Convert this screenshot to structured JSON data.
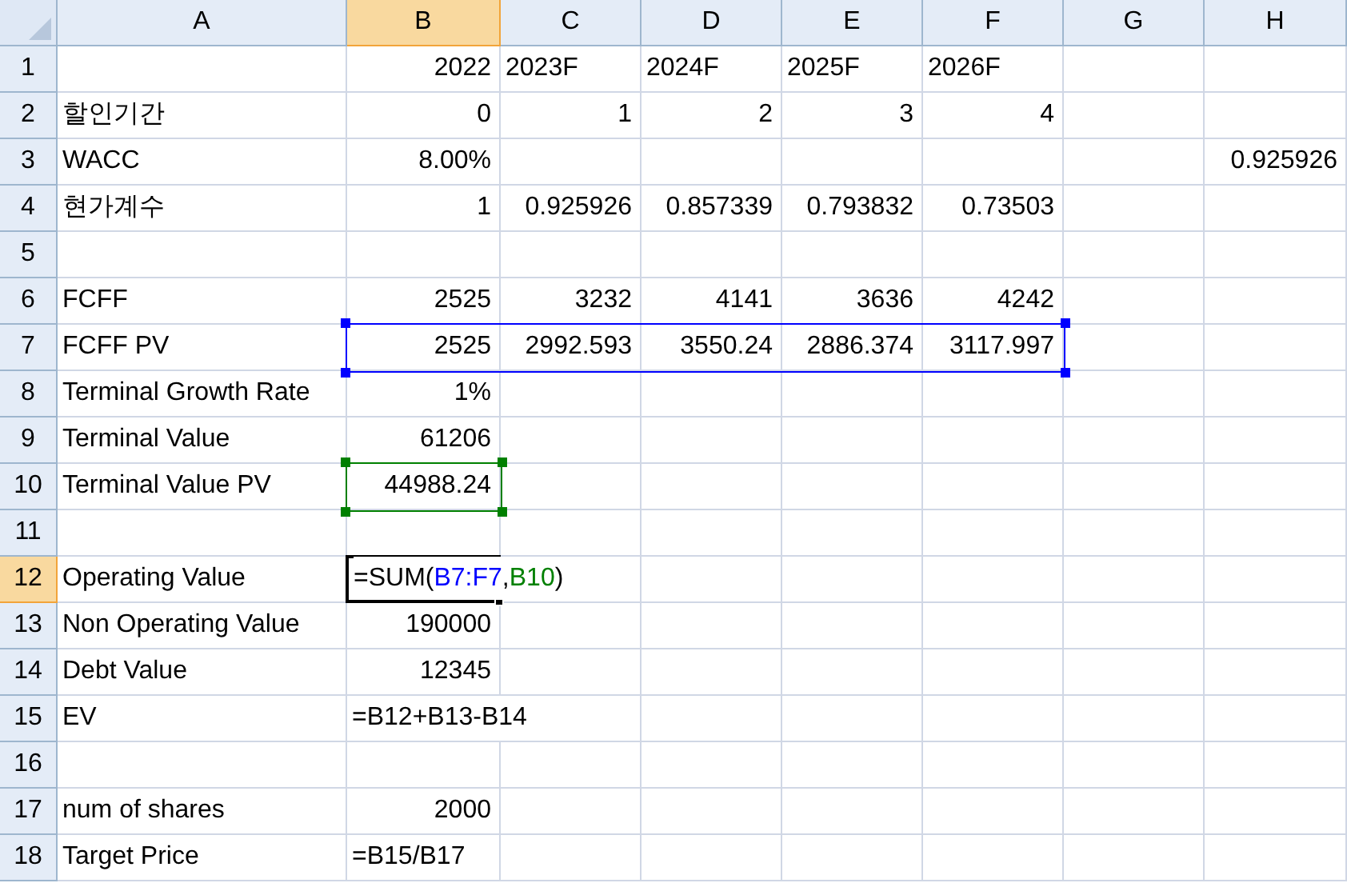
{
  "columns": [
    {
      "label": "A",
      "selected": false
    },
    {
      "label": "B",
      "selected": true
    },
    {
      "label": "C",
      "selected": false
    },
    {
      "label": "D",
      "selected": false
    },
    {
      "label": "E",
      "selected": false
    },
    {
      "label": "F",
      "selected": false
    },
    {
      "label": "G",
      "selected": false
    },
    {
      "label": "H",
      "selected": false
    }
  ],
  "rows": [
    {
      "number": "1",
      "selected": false,
      "cells": [
        null,
        {
          "kind": "number",
          "text": "2022"
        },
        {
          "kind": "text",
          "text": "2023F"
        },
        {
          "kind": "text",
          "text": "2024F"
        },
        {
          "kind": "text",
          "text": "2025F"
        },
        {
          "kind": "text",
          "text": "2026F"
        },
        null,
        null
      ]
    },
    {
      "number": "2",
      "selected": false,
      "cells": [
        {
          "kind": "text",
          "text": "할인기간"
        },
        {
          "kind": "number",
          "text": "0"
        },
        {
          "kind": "number",
          "text": "1"
        },
        {
          "kind": "number",
          "text": "2"
        },
        {
          "kind": "number",
          "text": "3"
        },
        {
          "kind": "number",
          "text": "4"
        },
        null,
        null
      ]
    },
    {
      "number": "3",
      "selected": false,
      "cells": [
        {
          "kind": "text",
          "text": "WACC"
        },
        {
          "kind": "number",
          "text": "8.00%"
        },
        null,
        null,
        null,
        null,
        null,
        {
          "kind": "number",
          "text": "0.925926"
        }
      ]
    },
    {
      "number": "4",
      "selected": false,
      "cells": [
        {
          "kind": "text",
          "text": "현가계수"
        },
        {
          "kind": "number",
          "text": "1"
        },
        {
          "kind": "number",
          "text": "0.925926"
        },
        {
          "kind": "number",
          "text": "0.857339"
        },
        {
          "kind": "number",
          "text": "0.793832"
        },
        {
          "kind": "number",
          "text": "0.73503"
        },
        null,
        null
      ]
    },
    {
      "number": "5",
      "selected": false,
      "cells": [
        null,
        null,
        null,
        null,
        null,
        null,
        null,
        null
      ]
    },
    {
      "number": "6",
      "selected": false,
      "cells": [
        {
          "kind": "text",
          "text": "FCFF"
        },
        {
          "kind": "number",
          "text": "2525"
        },
        {
          "kind": "number",
          "text": "3232"
        },
        {
          "kind": "number",
          "text": "4141"
        },
        {
          "kind": "number",
          "text": "3636"
        },
        {
          "kind": "number",
          "text": "4242"
        },
        null,
        null
      ]
    },
    {
      "number": "7",
      "selected": false,
      "cells": [
        {
          "kind": "text",
          "text": "FCFF PV"
        },
        {
          "kind": "number",
          "text": "2525",
          "color": "#0000ff"
        },
        {
          "kind": "number",
          "text": "2992.593",
          "color": "#0000ff"
        },
        {
          "kind": "number",
          "text": "3550.24",
          "color": "#0000ff"
        },
        {
          "kind": "number",
          "text": "2886.374",
          "color": "#0000ff"
        },
        {
          "kind": "number",
          "text": "3117.997",
          "color": "#0000ff"
        },
        null,
        null
      ]
    },
    {
      "number": "8",
      "selected": false,
      "cells": [
        {
          "kind": "text",
          "text": "Terminal Growth Rate"
        },
        {
          "kind": "number",
          "text": "1%"
        },
        null,
        null,
        null,
        null,
        null,
        null
      ]
    },
    {
      "number": "9",
      "selected": false,
      "cells": [
        {
          "kind": "text",
          "text": "Terminal Value"
        },
        {
          "kind": "number",
          "text": "61206"
        },
        null,
        null,
        null,
        null,
        null,
        null
      ]
    },
    {
      "number": "10",
      "selected": false,
      "cells": [
        {
          "kind": "text",
          "text": "Terminal Value PV"
        },
        {
          "kind": "number",
          "text": "44988.24",
          "color": "#008000"
        },
        null,
        null,
        null,
        null,
        null,
        null
      ]
    },
    {
      "number": "11",
      "selected": false,
      "cells": [
        null,
        null,
        null,
        null,
        null,
        null,
        null,
        null
      ]
    },
    {
      "number": "12",
      "selected": true,
      "cells": [
        {
          "kind": "text",
          "text": "Operating Value"
        },
        {
          "kind": "formula",
          "active": true,
          "overflows": true,
          "parts": [
            {
              "text": "=SUM(",
              "color": "#000000"
            },
            {
              "text": "B7:F7",
              "color": "#0000ff"
            },
            {
              "text": ",",
              "color": "#000000"
            },
            {
              "text": "B10",
              "color": "#008000"
            },
            {
              "text": ")",
              "color": "#000000"
            }
          ]
        },
        null,
        null,
        null,
        null,
        null,
        null
      ]
    },
    {
      "number": "13",
      "selected": false,
      "cells": [
        {
          "kind": "text",
          "text": "Non Operating Value"
        },
        {
          "kind": "number",
          "text": "190000"
        },
        null,
        null,
        null,
        null,
        null,
        null
      ]
    },
    {
      "number": "14",
      "selected": false,
      "cells": [
        {
          "kind": "text",
          "text": "Debt Value"
        },
        {
          "kind": "number",
          "text": "12345"
        },
        null,
        null,
        null,
        null,
        null,
        null
      ]
    },
    {
      "number": "15",
      "selected": false,
      "cells": [
        {
          "kind": "text",
          "text": "EV"
        },
        {
          "kind": "text",
          "text": "=B12+B13-B14",
          "overflows": true
        },
        null,
        null,
        null,
        null,
        null,
        null
      ]
    },
    {
      "number": "16",
      "selected": false,
      "cells": [
        null,
        null,
        null,
        null,
        null,
        null,
        null,
        null
      ]
    },
    {
      "number": "17",
      "selected": false,
      "cells": [
        {
          "kind": "text",
          "text": "num of shares"
        },
        {
          "kind": "number",
          "text": "2000"
        },
        null,
        null,
        null,
        null,
        null,
        null
      ]
    },
    {
      "number": "18",
      "selected": false,
      "cells": [
        {
          "kind": "text",
          "text": "Target Price"
        },
        {
          "kind": "text",
          "text": "=B15/B17"
        },
        null,
        null,
        null,
        null,
        null,
        null
      ]
    }
  ]
}
